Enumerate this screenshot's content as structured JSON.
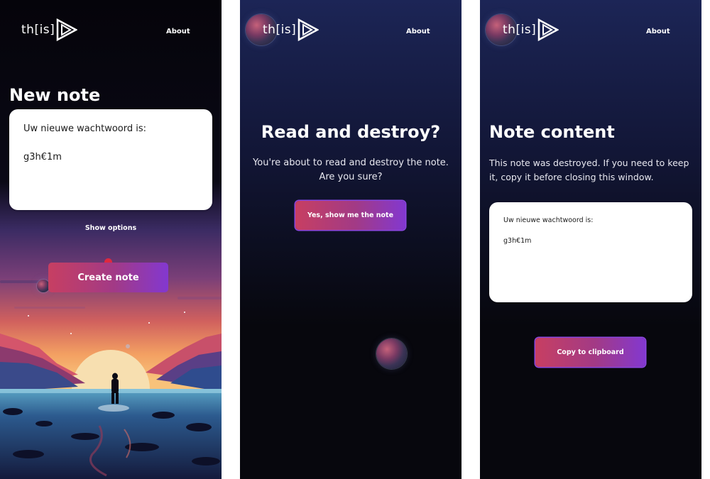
{
  "brand": {
    "logo_text": "th[is]"
  },
  "nav": {
    "about_label": "About"
  },
  "screen1": {
    "title": "New note",
    "note_text_line1": "Uw nieuwe wachtwoord is:",
    "note_text_line2": "g3h€1m",
    "show_options_label": "Show options",
    "create_button_label": "Create note"
  },
  "screen2": {
    "title": "Read and destroy?",
    "message_line1": "You're about to read and destroy the note.",
    "message_line2": "Are you sure?",
    "confirm_button_label": "Yes, show me the note"
  },
  "screen3": {
    "title": "Note content",
    "message_line1": "This note was destroyed. If you need to keep",
    "message_line2": "it, copy it before closing this window.",
    "note_text_line1": "Uw nieuwe wachtwoord is:",
    "note_text_line2": "g3h€1m",
    "copy_button_label": "Copy to clipboard"
  },
  "colors": {
    "button_gradient_start": "#c73f62",
    "button_gradient_end": "#8338d0",
    "dark_background": "#07070d",
    "navy_top": "#1c2556"
  }
}
